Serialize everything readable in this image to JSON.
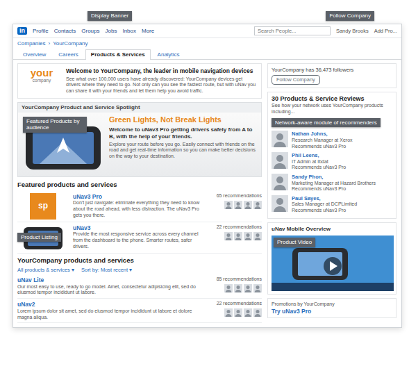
{
  "callouts": [
    {
      "label": "Display Banner"
    },
    {
      "label": "Follow Company"
    },
    {
      "label": "Featured Products by audience"
    },
    {
      "label": "Network-aware module of recommenders"
    },
    {
      "label": "Product Listing"
    },
    {
      "label": "Product Video"
    }
  ],
  "topbar": {
    "logo": "in",
    "nav": [
      "Profile",
      "Contacts",
      "Groups",
      "Jobs",
      "Inbox",
      "More"
    ],
    "search": "Search People...",
    "user": "Sandy Brooks",
    "add": "Add Pro..."
  },
  "breadcrumb": [
    "Companies",
    "›",
    "YourCompany"
  ],
  "tabs": [
    {
      "label": "Overview",
      "selected": false
    },
    {
      "label": "Careers",
      "selected": false
    },
    {
      "label": "Products & Services",
      "selected": true
    },
    {
      "label": "Analytics",
      "selected": false
    }
  ],
  "banner": {
    "logo": "your",
    "logo_sub": "company",
    "title": "Welcome to YourCompany, the leader in mobile navigation devices",
    "text": "See what over 100,000 users have already discovered: YourCompany devices get drivers where they need to go. Not only can you see the fastest route, but with uNav you can share it with your friends and let them help you avoid traffic."
  },
  "spotlight": {
    "title": "YourCompany Product and Service Spotlight",
    "headline": "Green Lights, Not Break Lights",
    "subhead": "Welcome to uNav3 Pro getting drivers safely from A to B, with the help of your friends.",
    "text": "Explore your route before you go. Easily connect with friends on the road and get real-time information so you can make better decisions on the way to your destination."
  },
  "featured": {
    "title": "Featured products and services",
    "items": [
      {
        "kind": "badge",
        "badge": "sp",
        "name": "uNav3 Pro",
        "text": "Don't just navigate: eliminate everything they need to know about the road ahead, with less distraction. The uNav3 Pro gets you there.",
        "recommendations": "65 recommendations"
      },
      {
        "kind": "device",
        "name": "uNav3",
        "text": "Provide the most responsive service across every channel from the dashboard to the phone. Smarter routes, safer drivers.",
        "recommendations": "22 recommendations"
      }
    ]
  },
  "listing": {
    "title": "YourCompany products and services",
    "filter": "All products & services ▾",
    "sort": "Sort by: Most recent ▾",
    "items": [
      {
        "name": "uNav Lite",
        "text": "Our most easy to use, ready to go model. Amet, consectetur adipisicing elit, sed do eiusmod tempor incididunt ut labore.",
        "recommendations": "85 recommendations"
      },
      {
        "name": "uNav2",
        "text": "Lorem ipsum dolor sit amet, sed do eiusmod tempor incididunt ut labore et dolore magna aliqua.",
        "recommendations": "22 recommendations"
      }
    ]
  },
  "follow": {
    "count": "YourCompany has 36,473 followers",
    "button": "Follow Company"
  },
  "reviews": {
    "title": "30 Products & Service Reviews",
    "text": "See how your network uses YourCompany products including...",
    "people": [
      {
        "name": "Nathan Johns,",
        "role": "Research Manager at Xerox",
        "rec": "Recommends uNav3 Pro"
      },
      {
        "name": "Phil Leens,",
        "role": "IT Admin at Ibdat",
        "rec": "Recommends uNav3 Pro"
      },
      {
        "name": "Sandy Phon,",
        "role": "Marketing Manager at Hazard Brothers",
        "rec": "Recommends uNav3 Pro"
      },
      {
        "name": "Paul Sayes,",
        "role": "Sales Manager at DCPLimited",
        "rec": "Recommends uNav3 Pro"
      }
    ]
  },
  "video": {
    "title": "uNav Mobile Overview"
  },
  "promo": {
    "title": "Promotions by YourCompany",
    "link": "Try uNav3 Pro"
  }
}
